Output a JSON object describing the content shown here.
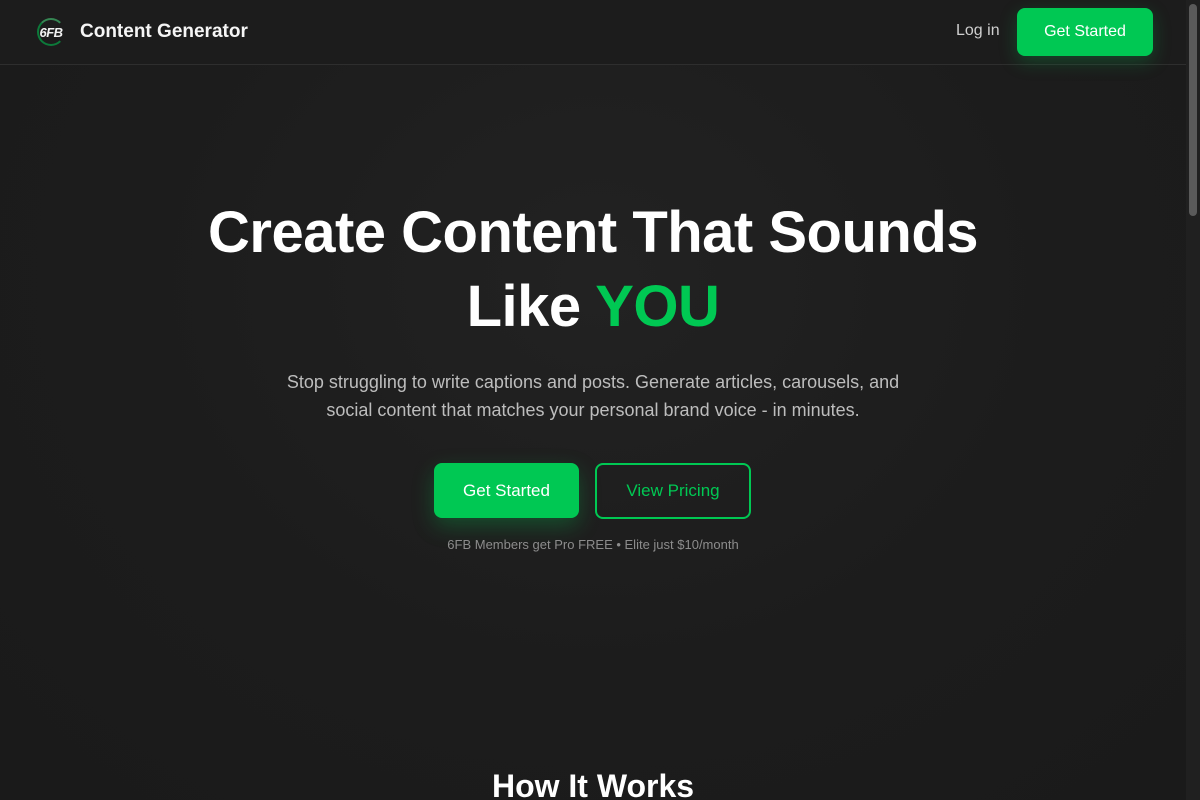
{
  "header": {
    "logo_text": "6FB",
    "brand_name": "Content Generator",
    "login_label": "Log in",
    "cta_label": "Get Started"
  },
  "hero": {
    "title_line1": "Create Content That Sounds",
    "title_line2_prefix": "Like ",
    "title_line2_accent": "YOU",
    "subtitle_line1": "Stop struggling to write captions and posts. Generate articles, carousels, and",
    "subtitle_line2": "social content that matches your personal brand voice - in minutes.",
    "primary_cta": "Get Started",
    "secondary_cta": "View Pricing",
    "note": "6FB Members get Pro FREE • Elite just $10/month"
  },
  "sections": {
    "how_it_works": "How It Works"
  },
  "colors": {
    "accent": "#00c853",
    "background": "#1b1b1b",
    "text_muted": "#bdbdbd"
  }
}
